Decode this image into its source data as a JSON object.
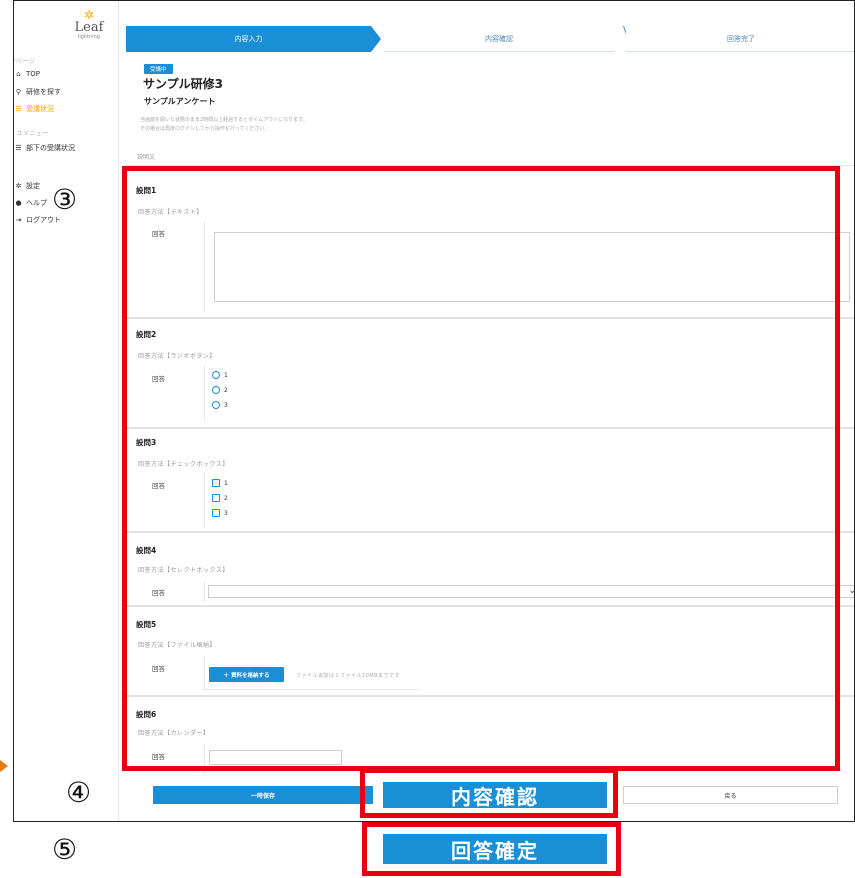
{
  "sidebar": {
    "logo_text": "Leaf",
    "logo_sub": "lightning",
    "mypage_section": "MYページ",
    "items": [
      {
        "label": "TOP",
        "icon": "home-icon"
      },
      {
        "label": "研修を探す",
        "icon": "search-icon"
      },
      {
        "label": "受講状況",
        "icon": "list-icon",
        "active": true
      }
    ],
    "menu_section": "ユメニュー",
    "sub_items": [
      {
        "label": "部下の受講状況",
        "icon": "list-icon"
      }
    ],
    "bottom_items": [
      {
        "label": "設定",
        "icon": "gear-icon"
      },
      {
        "label": "ヘルプ",
        "icon": "help-icon"
      },
      {
        "label": "ログアウト",
        "icon": "logout-icon"
      }
    ]
  },
  "steps": [
    {
      "label": "内容入力",
      "state": "active"
    },
    {
      "label": "内容確認",
      "state": "inactive"
    },
    {
      "label": "回答完了",
      "state": "inactive"
    }
  ],
  "header": {
    "badge": "受講中",
    "title": "サンプル研修3",
    "subtitle": "サンプルアンケート",
    "notice_line1": "当画面を開いた状態のまま2時間以上経過するとタイムアウトになります。",
    "notice_line2": "その場合は再度ログインしてから操作を行ってください。",
    "description_label": "説明文"
  },
  "questions": [
    {
      "title": "設問1",
      "method": "回答方法【テキスト】",
      "answer_label": "回答"
    },
    {
      "title": "設問2",
      "method": "回答方法【ラジオボタン】",
      "answer_label": "回答",
      "options": [
        "1",
        "2",
        "3"
      ]
    },
    {
      "title": "設問3",
      "method": "回答方法【チェックボックス】",
      "answer_label": "回答",
      "options": [
        "1",
        "2",
        "3"
      ]
    },
    {
      "title": "設問4",
      "method": "回答方法【セレクトボックス】",
      "answer_label": "回答"
    },
    {
      "title": "設問5",
      "method": "回答方法【ファイル格納】",
      "answer_label": "回答",
      "upload_button": "＋ 資料を格納する",
      "upload_note": "ファイル追加は１ファイル20MBまでです"
    },
    {
      "title": "設問6",
      "method": "回答方法【カレンダー】",
      "answer_label": "回答"
    }
  ],
  "footer": {
    "save_label": "一時保存",
    "confirm_label": "内容確認",
    "back_label": "戻る"
  },
  "annotations": {
    "num3": "③",
    "num4": "④",
    "num5": "⑤",
    "final_label": "回答確定",
    "box_color": "#e60012"
  },
  "colors": {
    "accent": "#1a8fd6",
    "active_nav": "#f4a200"
  }
}
